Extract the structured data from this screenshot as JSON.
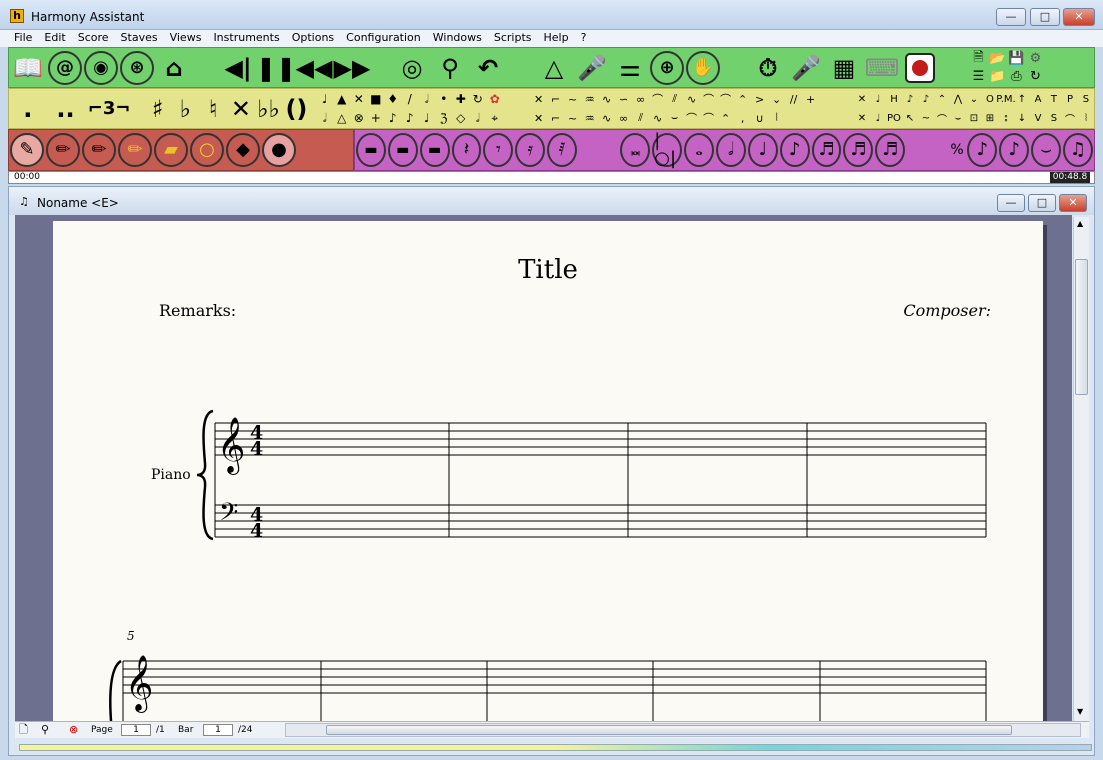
{
  "window": {
    "title": "Harmony Assistant",
    "app_icon": "h",
    "minimize": "—",
    "maximize": "□",
    "close": "✕"
  },
  "menu": [
    "File",
    "Edit",
    "Score",
    "Staves",
    "Views",
    "Instruments",
    "Options",
    "Configuration",
    "Windows",
    "Scripts",
    "Help",
    "?"
  ],
  "timebar": {
    "start": "00:00",
    "end": "00:48.8"
  },
  "document": {
    "title": "Noname <E>",
    "minimize": "—",
    "maximize": "□",
    "close": "✕"
  },
  "score": {
    "title": "Title",
    "remarks": "Remarks:",
    "composer": "Composer:",
    "instrument": "Piano",
    "time_signature": "4/4",
    "second_system_bar": "5"
  },
  "status": {
    "page_label": "Page",
    "page_value": "1",
    "page_total": "/1",
    "bar_label": "Bar",
    "bar_value": "1",
    "bar_total": "/24"
  },
  "toolbars": {
    "row1": [
      "book-icon",
      "at-icon",
      "globe-icon",
      "globe-upload-icon",
      "lock-icon",
      "play-icon",
      "pause-icon",
      "rewind-icon",
      "fast-forward-icon",
      "eye-play-icon",
      "search-play-icon",
      "undo-play-icon",
      "metronome-icon",
      "microphone-icon",
      "mixer-icon",
      "drum-icon",
      "hand-icon",
      "timer-keyboard-icon",
      "microphone-mute-icon",
      "keyboard-record-icon",
      "keyboard-icon",
      "record-icon"
    ],
    "row3_tools": [
      "eraser-tool-icon",
      "pencil-tool-icon",
      "pencil-alt-icon",
      "pencil-yellow-icon",
      "eraser-yellow-icon",
      "magnifier-yellow-icon",
      "diamond-tool-icon",
      "magnifier-black-icon"
    ],
    "row3_notes": [
      "whole-rest",
      "half-rest",
      "quarter-rest",
      "crotchet-rest",
      "eighth-rest",
      "sixteenth-rest",
      "thirtysecond-rest",
      "breve",
      "double-whole",
      "whole-note",
      "half-note",
      "quarter-note",
      "eighth-note",
      "sixteenth-note",
      "thirtysecond-note",
      "sixtyfourth-note"
    ]
  },
  "colors": {
    "toolbar1": "#71d16d",
    "toolbar2": "#e3e48c",
    "toolbar3a": "#c65b52",
    "toolbar3b": "#c463c4"
  }
}
